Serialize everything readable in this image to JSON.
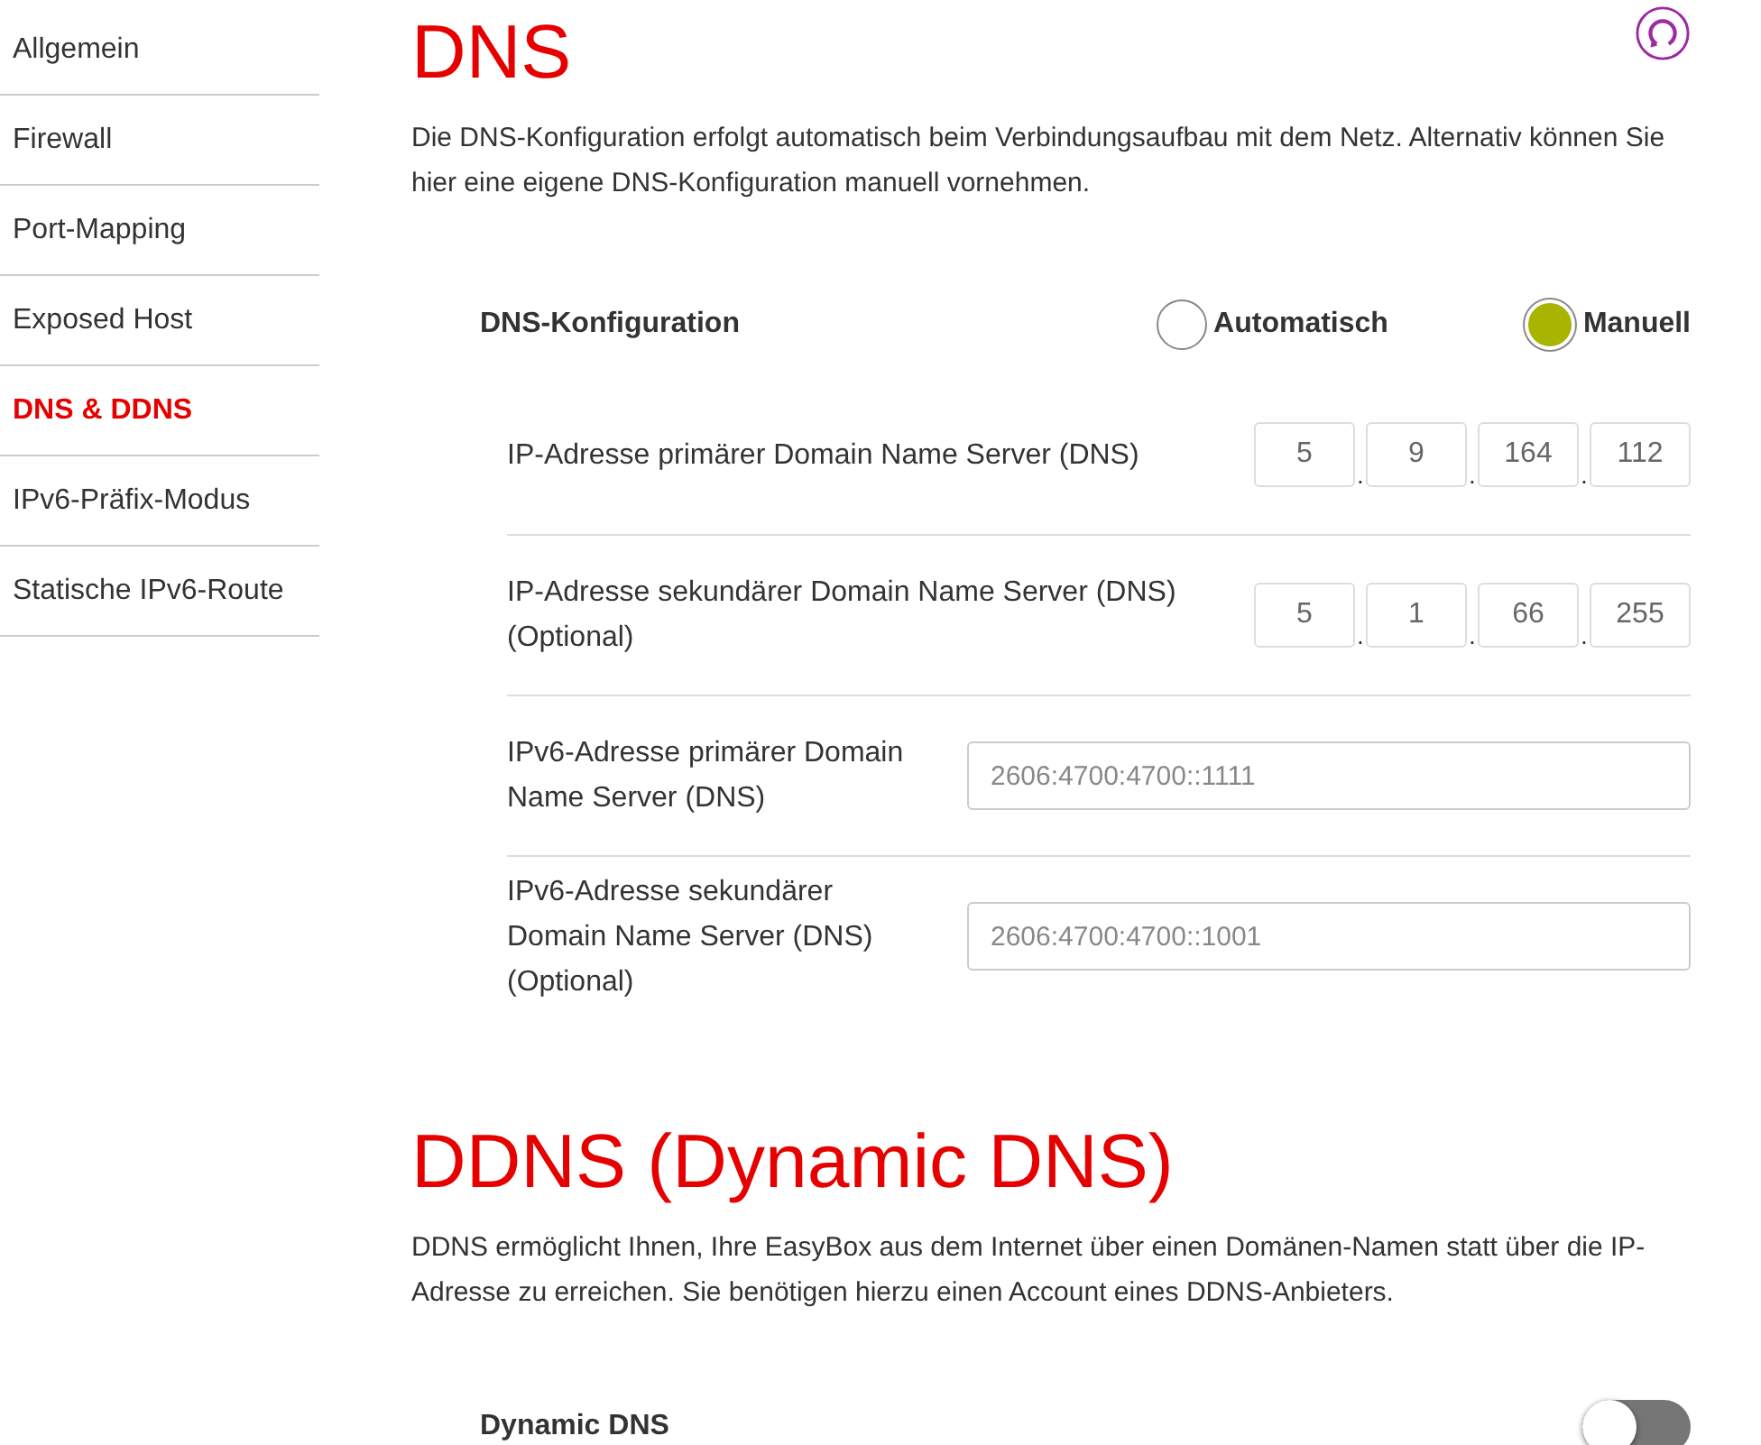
{
  "sidebar": {
    "items": [
      {
        "label": "Allgemein",
        "selected": false
      },
      {
        "label": "Firewall",
        "selected": false
      },
      {
        "label": "Port-Mapping",
        "selected": false
      },
      {
        "label": "Exposed Host",
        "selected": false
      },
      {
        "label": "DNS & DDNS",
        "selected": true
      },
      {
        "label": "IPv6-Präfix-Modus",
        "selected": false
      },
      {
        "label": "Statische IPv6-Route",
        "selected": false
      }
    ]
  },
  "dns": {
    "title": "DNS",
    "description": "Die DNS-Konfiguration erfolgt automatisch beim Verbindungsaufbau mit dem Netz. Alternativ können Sie hier eine eigene DNS-Konfiguration manuell vornehmen.",
    "mode": {
      "label": "DNS-Konfiguration",
      "options": [
        {
          "label": "Automatisch",
          "selected": false
        },
        {
          "label": "Manuell",
          "selected": true
        }
      ]
    },
    "fields": [
      {
        "kind": "ipv4",
        "label": "IP-Adresse primärer Domain Name Server (DNS)",
        "octets": [
          "5",
          "9",
          "164",
          "112"
        ],
        "separator": "."
      },
      {
        "kind": "ipv4",
        "label": "IP-Adresse sekundärer Domain Name Server (DNS) (Optional)",
        "octets": [
          "5",
          "1",
          "66",
          "255"
        ],
        "separator": "."
      },
      {
        "kind": "text",
        "label": "IPv6-Adresse primärer Domain Name Server (DNS)",
        "value": "2606:4700:4700::1111"
      },
      {
        "kind": "text",
        "label": "IPv6-Adresse sekundärer Domain Name Server (DNS) (Optional)",
        "value": "2606:4700:4700::1001"
      }
    ]
  },
  "ddns": {
    "title": "DDNS (Dynamic DNS)",
    "description": "DDNS ermöglicht Ihnen, Ihre EasyBox aus dem Internet über einen Domänen-Namen statt über die IP-Adresse zu erreichen. Sie benötigen hierzu einen Account eines DDNS-Anbieters.",
    "toggle": {
      "label": "Dynamic DNS",
      "on": false
    }
  }
}
